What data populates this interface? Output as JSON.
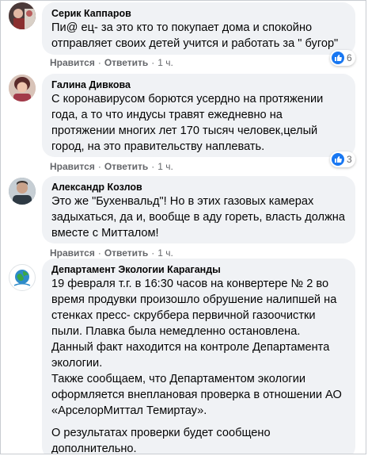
{
  "comments": [
    {
      "author": "Серик Каппаров",
      "lines": [
        "Пи@ ец- за это кто то покупает дома и спокойно отправляет своих детей учится и работать за \" бугор\""
      ],
      "like_label": "Нравится",
      "reply_label": "Ответить",
      "time": "1 ч.",
      "reactions": {
        "icon": "like-icon",
        "count": "6"
      }
    },
    {
      "author": "Галина Дивкова",
      "lines": [
        "С коронавирусом борются усердно на протяжении года, а то что индусы травят ежедневно на протяжении многих лет 170 тысяч человек,целый город, на это правительству наплевать."
      ],
      "like_label": "Нравится",
      "reply_label": "Ответить",
      "time": "1 ч.",
      "reactions": {
        "icon": "like-icon",
        "count": "3"
      }
    },
    {
      "author": "Александр Козлов",
      "lines": [
        "Это же \"Бухенвальд\"! Но в этих газовых камерах задыхаться, да и, вообще в аду гореть, власть должна вместе с Митталом!"
      ],
      "like_label": "Нравится",
      "reply_label": "Ответить",
      "time": "1 ч."
    },
    {
      "author": "Департамент Экологии Караганды",
      "lines": [
        "19 февраля т.г. в 16:30 часов на конвертере № 2 во время продувки произошло обрушение налипшей на стенках пресс- скруббера первичной газоочистки пыли. Плавка была немедленно остановлена.",
        "Данный факт находится на контроле Департамента экологии.",
        "Также сообщаем, что Департаментом экологии оформляется внеплановая проверка в отношении АО «АрселорМиттал Темиртау».",
        "О результатах проверки будет сообщено дополнительно."
      ]
    }
  ],
  "colors": {
    "bubble": "#f0f2f5",
    "meta": "#65676b",
    "like_blue": "#1877f2"
  }
}
